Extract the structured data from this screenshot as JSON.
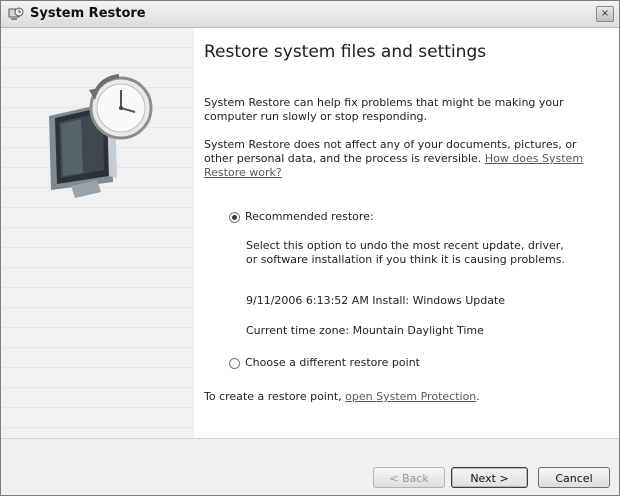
{
  "window": {
    "title": "System Restore",
    "close_glyph": "×",
    "icon": "system-restore-icon"
  },
  "content": {
    "heading": "Restore system files and settings",
    "para1": "System Restore can help fix problems that might be making your computer run slowly or stop responding.",
    "para2_text": "System Restore does not affect any of your documents, pictures, or other personal data, and the process is reversible.",
    "para2_link": "How does System Restore work?",
    "options": {
      "recommended": {
        "label": "Recommended restore:",
        "selected": true,
        "description": "Select this option to undo the most recent update, driver, or software installation if you think it is causing problems.",
        "restore_point": "9/11/2006 6:13:52 AM Install: Windows Update",
        "timezone": "Current time zone: Mountain Daylight Time"
      },
      "different": {
        "label": "Choose a different restore point",
        "selected": false
      }
    },
    "protection_text": "To create a restore point,",
    "protection_link": "open System Protection",
    "protection_end": "."
  },
  "buttons": {
    "back": "< Back",
    "next": "Next >",
    "cancel": "Cancel"
  }
}
